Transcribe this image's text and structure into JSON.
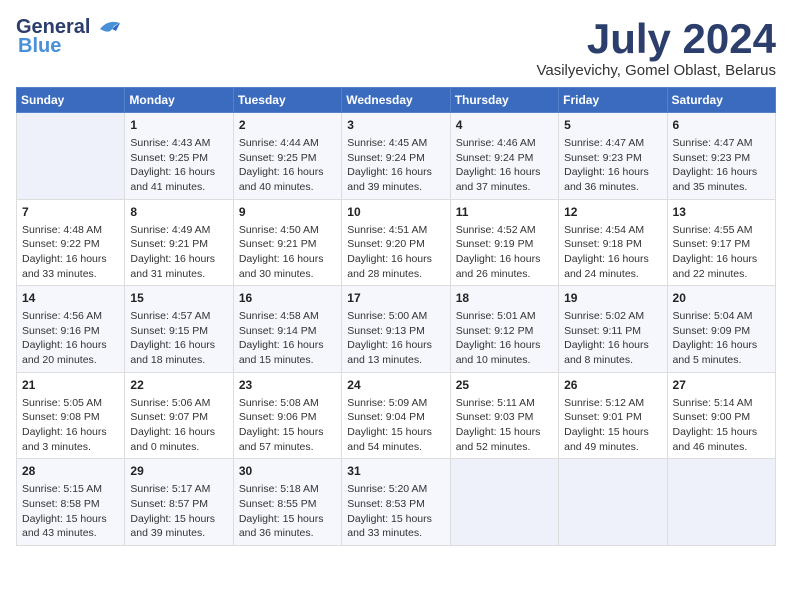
{
  "header": {
    "logo_line1": "General",
    "logo_line2": "Blue",
    "month_title": "July 2024",
    "location": "Vasilyevichy, Gomel Oblast, Belarus"
  },
  "weekdays": [
    "Sunday",
    "Monday",
    "Tuesday",
    "Wednesday",
    "Thursday",
    "Friday",
    "Saturday"
  ],
  "weeks": [
    [
      {
        "day": "",
        "info": ""
      },
      {
        "day": "1",
        "info": "Sunrise: 4:43 AM\nSunset: 9:25 PM\nDaylight: 16 hours\nand 41 minutes."
      },
      {
        "day": "2",
        "info": "Sunrise: 4:44 AM\nSunset: 9:25 PM\nDaylight: 16 hours\nand 40 minutes."
      },
      {
        "day": "3",
        "info": "Sunrise: 4:45 AM\nSunset: 9:24 PM\nDaylight: 16 hours\nand 39 minutes."
      },
      {
        "day": "4",
        "info": "Sunrise: 4:46 AM\nSunset: 9:24 PM\nDaylight: 16 hours\nand 37 minutes."
      },
      {
        "day": "5",
        "info": "Sunrise: 4:47 AM\nSunset: 9:23 PM\nDaylight: 16 hours\nand 36 minutes."
      },
      {
        "day": "6",
        "info": "Sunrise: 4:47 AM\nSunset: 9:23 PM\nDaylight: 16 hours\nand 35 minutes."
      }
    ],
    [
      {
        "day": "7",
        "info": "Sunrise: 4:48 AM\nSunset: 9:22 PM\nDaylight: 16 hours\nand 33 minutes."
      },
      {
        "day": "8",
        "info": "Sunrise: 4:49 AM\nSunset: 9:21 PM\nDaylight: 16 hours\nand 31 minutes."
      },
      {
        "day": "9",
        "info": "Sunrise: 4:50 AM\nSunset: 9:21 PM\nDaylight: 16 hours\nand 30 minutes."
      },
      {
        "day": "10",
        "info": "Sunrise: 4:51 AM\nSunset: 9:20 PM\nDaylight: 16 hours\nand 28 minutes."
      },
      {
        "day": "11",
        "info": "Sunrise: 4:52 AM\nSunset: 9:19 PM\nDaylight: 16 hours\nand 26 minutes."
      },
      {
        "day": "12",
        "info": "Sunrise: 4:54 AM\nSunset: 9:18 PM\nDaylight: 16 hours\nand 24 minutes."
      },
      {
        "day": "13",
        "info": "Sunrise: 4:55 AM\nSunset: 9:17 PM\nDaylight: 16 hours\nand 22 minutes."
      }
    ],
    [
      {
        "day": "14",
        "info": "Sunrise: 4:56 AM\nSunset: 9:16 PM\nDaylight: 16 hours\nand 20 minutes."
      },
      {
        "day": "15",
        "info": "Sunrise: 4:57 AM\nSunset: 9:15 PM\nDaylight: 16 hours\nand 18 minutes."
      },
      {
        "day": "16",
        "info": "Sunrise: 4:58 AM\nSunset: 9:14 PM\nDaylight: 16 hours\nand 15 minutes."
      },
      {
        "day": "17",
        "info": "Sunrise: 5:00 AM\nSunset: 9:13 PM\nDaylight: 16 hours\nand 13 minutes."
      },
      {
        "day": "18",
        "info": "Sunrise: 5:01 AM\nSunset: 9:12 PM\nDaylight: 16 hours\nand 10 minutes."
      },
      {
        "day": "19",
        "info": "Sunrise: 5:02 AM\nSunset: 9:11 PM\nDaylight: 16 hours\nand 8 minutes."
      },
      {
        "day": "20",
        "info": "Sunrise: 5:04 AM\nSunset: 9:09 PM\nDaylight: 16 hours\nand 5 minutes."
      }
    ],
    [
      {
        "day": "21",
        "info": "Sunrise: 5:05 AM\nSunset: 9:08 PM\nDaylight: 16 hours\nand 3 minutes."
      },
      {
        "day": "22",
        "info": "Sunrise: 5:06 AM\nSunset: 9:07 PM\nDaylight: 16 hours\nand 0 minutes."
      },
      {
        "day": "23",
        "info": "Sunrise: 5:08 AM\nSunset: 9:06 PM\nDaylight: 15 hours\nand 57 minutes."
      },
      {
        "day": "24",
        "info": "Sunrise: 5:09 AM\nSunset: 9:04 PM\nDaylight: 15 hours\nand 54 minutes."
      },
      {
        "day": "25",
        "info": "Sunrise: 5:11 AM\nSunset: 9:03 PM\nDaylight: 15 hours\nand 52 minutes."
      },
      {
        "day": "26",
        "info": "Sunrise: 5:12 AM\nSunset: 9:01 PM\nDaylight: 15 hours\nand 49 minutes."
      },
      {
        "day": "27",
        "info": "Sunrise: 5:14 AM\nSunset: 9:00 PM\nDaylight: 15 hours\nand 46 minutes."
      }
    ],
    [
      {
        "day": "28",
        "info": "Sunrise: 5:15 AM\nSunset: 8:58 PM\nDaylight: 15 hours\nand 43 minutes."
      },
      {
        "day": "29",
        "info": "Sunrise: 5:17 AM\nSunset: 8:57 PM\nDaylight: 15 hours\nand 39 minutes."
      },
      {
        "day": "30",
        "info": "Sunrise: 5:18 AM\nSunset: 8:55 PM\nDaylight: 15 hours\nand 36 minutes."
      },
      {
        "day": "31",
        "info": "Sunrise: 5:20 AM\nSunset: 8:53 PM\nDaylight: 15 hours\nand 33 minutes."
      },
      {
        "day": "",
        "info": ""
      },
      {
        "day": "",
        "info": ""
      },
      {
        "day": "",
        "info": ""
      }
    ]
  ]
}
